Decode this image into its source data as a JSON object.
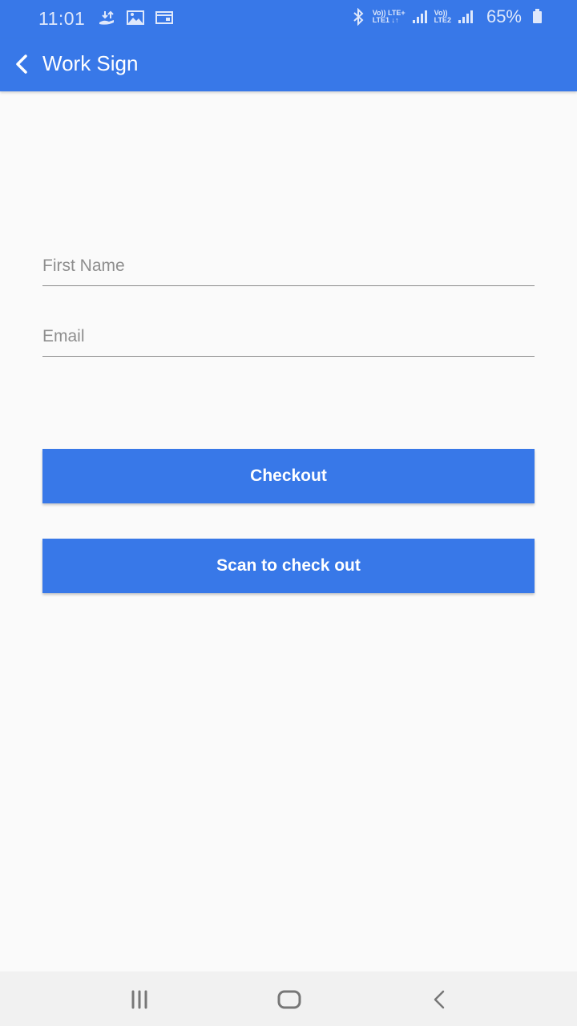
{
  "status_bar": {
    "time": "11:01",
    "left_icons": [
      "data-transfer-icon",
      "image-icon",
      "card-icon"
    ],
    "bluetooth": "bluetooth-icon",
    "sim1": {
      "top": "Vo)) LTE+",
      "bottom": "LTE1 ↓↑"
    },
    "sim2": {
      "top": "Vo))",
      "bottom": "LTE2"
    },
    "battery_percent": "65%"
  },
  "app_bar": {
    "title": "Work Sign",
    "back_icon": "chevron-left-icon",
    "color": "#3878e8"
  },
  "form": {
    "first_name": {
      "placeholder": "First Name",
      "value": ""
    },
    "email": {
      "placeholder": "Email",
      "value": ""
    }
  },
  "buttons": {
    "checkout_label": "Checkout",
    "scan_label": "Scan to check out"
  },
  "nav_bar": {
    "recents": "recents-icon",
    "home": "home-icon",
    "back": "back-icon"
  }
}
